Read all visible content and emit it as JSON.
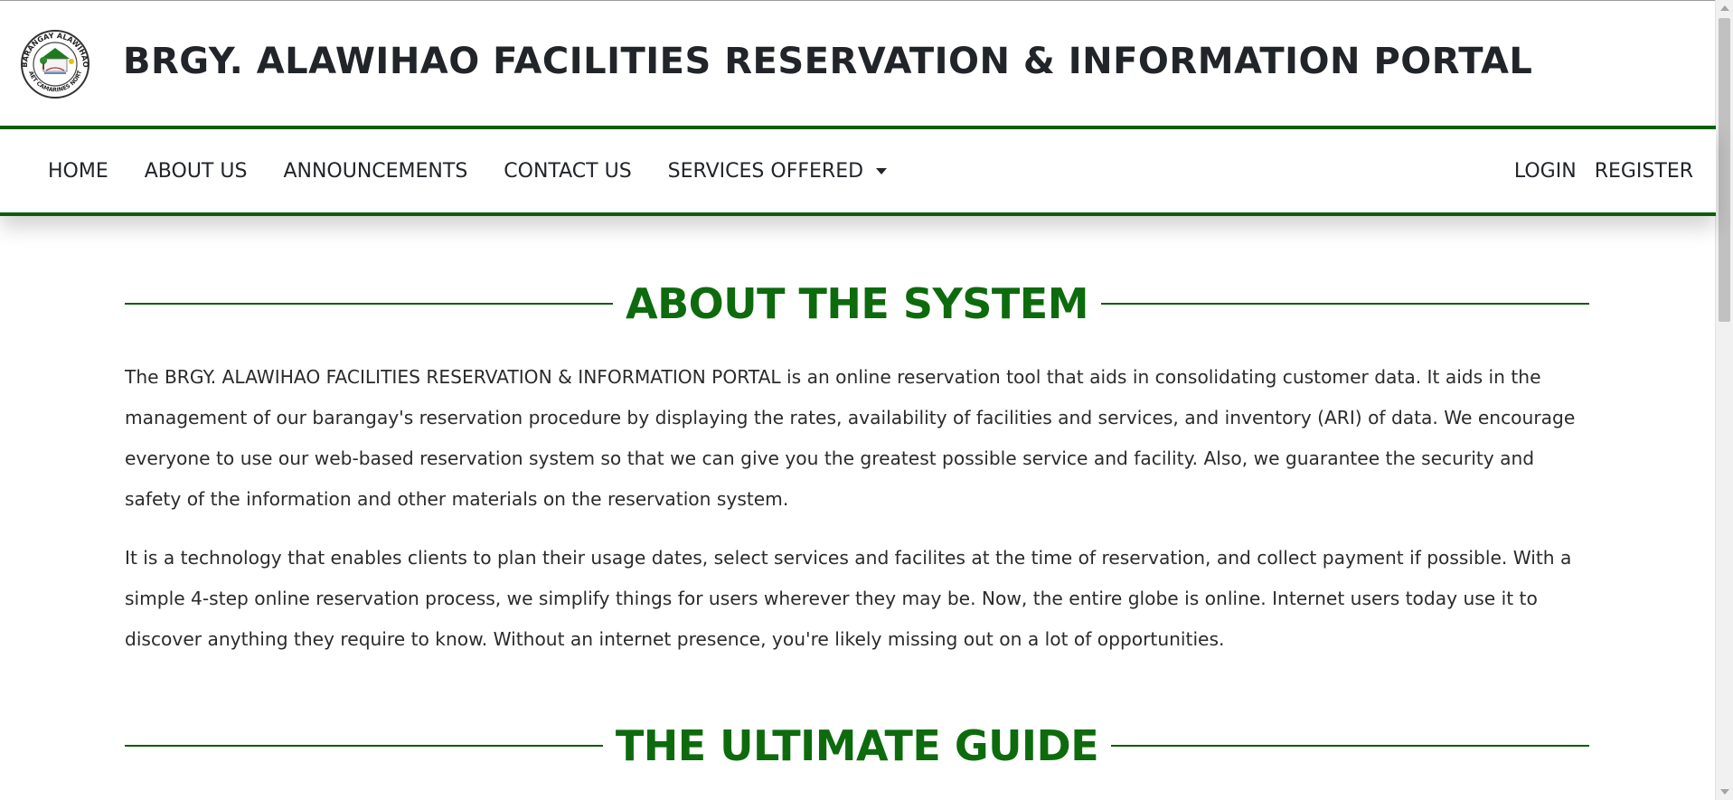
{
  "header": {
    "title": "BRGY. ALAWIHAO FACILITIES RESERVATION & INFORMATION PORTAL",
    "logo": {
      "top_text": "BARANGAY ALAWIHAO",
      "bottom_text": "DAET CAMARINES NORTE"
    }
  },
  "nav": {
    "left": [
      {
        "label": "HOME"
      },
      {
        "label": "ABOUT US"
      },
      {
        "label": "ANNOUNCEMENTS"
      },
      {
        "label": "CONTACT US"
      },
      {
        "label": "SERVICES OFFERED"
      }
    ],
    "right": [
      {
        "label": "LOGIN"
      },
      {
        "label": "REGISTER"
      }
    ]
  },
  "about": {
    "heading": "ABOUT THE SYSTEM",
    "paragraphs": [
      "The BRGY. ALAWIHAO FACILITIES RESERVATION & INFORMATION PORTAL is an online reservation tool that aids in consolidating customer data. It aids in the management of our barangay's reservation procedure by displaying the rates, availability of facilities and services, and inventory (ARI) of data. We encourage everyone to use our web-based reservation system so that we can give you the greatest possible service and facility. Also, we guarantee the security and safety of the information and other materials on the reservation system.",
      "It is a technology that enables clients to plan their usage dates, select services and facilites at the time of reservation, and collect payment if possible. With a simple 4-step online reservation process, we simplify things for users wherever they may be. Now, the entire globe is online. Internet users today use it to discover anything they require to know. Without an internet presence, you're likely missing out on a lot of opportunities."
    ]
  },
  "guide": {
    "heading": "THE ULTIMATE GUIDE"
  },
  "colors": {
    "accent_green": "#0d6b0d",
    "rule_green": "#0d5c0d",
    "text": "#212529"
  }
}
